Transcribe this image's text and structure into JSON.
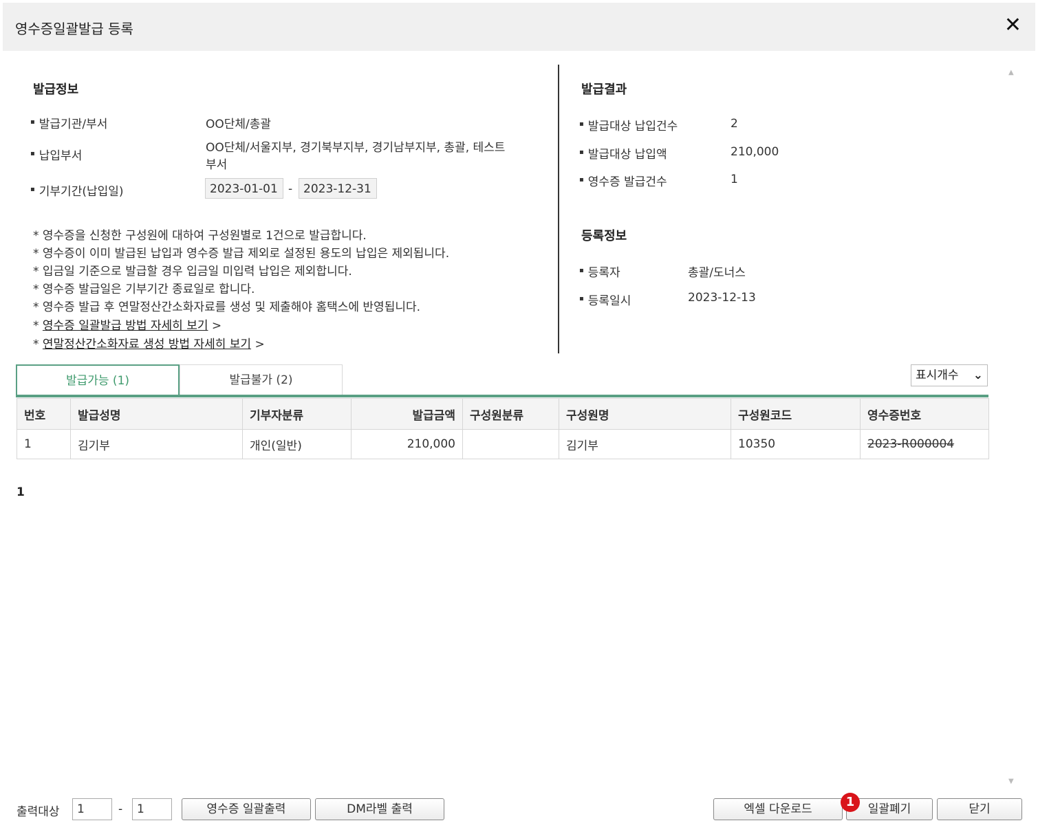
{
  "window": {
    "title": "영수증일괄발급 등록",
    "close_icon": "close-icon"
  },
  "issue_info": {
    "title": "발급정보",
    "org_label": "발급기관/부서",
    "org_value": "OO단체/총괄",
    "dept_label": "납입부서",
    "dept_value_line1": "OO단체/서울지부, 경기북부지부, 경기남부지부, 총괄, 테스트",
    "dept_value_line2": "부서",
    "period_label": "기부기간(납입일)",
    "period_start": "2023-01-01",
    "period_sep": "-",
    "period_end": "2023-12-31"
  },
  "notes": [
    "* 영수증을 신청한 구성원에 대하여 구성원별로 1건으로 발급합니다.",
    "* 영수증이 이미 발급된 납입과 영수증 발급 제외로 설정된 용도의 납입은 제외됩니다.",
    "* 입금일 기준으로 발급할 경우 입금일 미입력 납입은 제외합니다.",
    "* 영수증 발급일은 기부기간 종료일로 합니다.",
    "* 영수증 발급 후 연말정산간소화자료를 생성 및 제출해야 홈택스에 반영됩니다."
  ],
  "links": [
    {
      "prefix": "* ",
      "text": "영수증 일괄발급 방법 자세히 보기",
      "suffix": " >"
    },
    {
      "prefix": "* ",
      "text": "연말정산간소화자료 생성 방법 자세히 보기",
      "suffix": " >"
    }
  ],
  "issue_result": {
    "title": "발급결과",
    "target_count_label": "발급대상 납입건수",
    "target_count_value": "2",
    "target_amount_label": "발급대상 납입액",
    "target_amount_value": "210,000",
    "receipt_count_label": "영수증 발급건수",
    "receipt_count_value": "1"
  },
  "registration": {
    "title": "등록정보",
    "registrant_label": "등록자",
    "registrant_value": "총괄/도너스",
    "date_label": "등록일시",
    "date_value": "2023-12-13"
  },
  "tabs": [
    {
      "label": "발급가능 (1)",
      "active": true
    },
    {
      "label": "발급불가 (2)",
      "active": false
    }
  ],
  "display_count": {
    "label": "표시개수",
    "icon": "chevron-down-icon"
  },
  "table": {
    "headers": [
      "번호",
      "발급성명",
      "기부자분류",
      "발급금액",
      "구성원분류",
      "구성원명",
      "구성원코드",
      "영수증번호"
    ],
    "rows": [
      {
        "no": "1",
        "name": "김기부",
        "donor_type": "개인(일반)",
        "amount": "210,000",
        "member_type": "",
        "member_name": "김기부",
        "member_code": "10350",
        "receipt_no": "2023-R000004"
      }
    ]
  },
  "pagination": {
    "current": "1"
  },
  "footer": {
    "output_label": "출력대상",
    "from_value": "1",
    "sep": "-",
    "to_value": "1",
    "print_receipts": "영수증 일괄출력",
    "print_dm": "DM라벨 출력",
    "excel_download": "엑셀 다운로드",
    "bulk_cancel": "일괄폐기",
    "close": "닫기",
    "badge": "1"
  }
}
